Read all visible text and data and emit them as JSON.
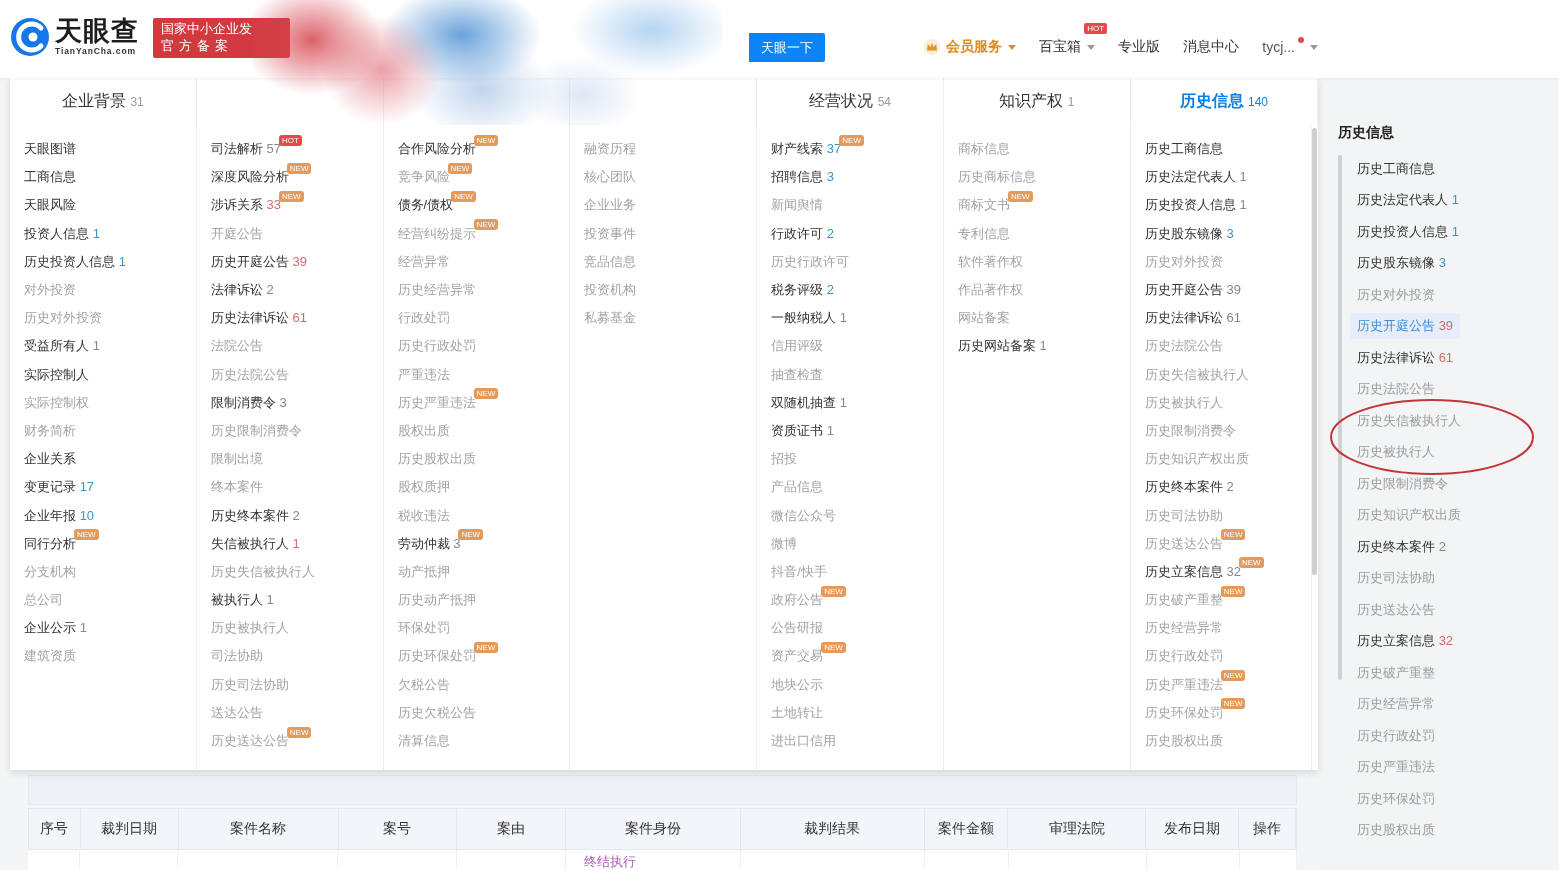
{
  "header": {
    "logo": {
      "name": "天眼查",
      "domain": "TianYanCha.com"
    },
    "certification": [
      "国家中小企业发",
      "官方备案"
    ],
    "search_button": "天眼一下",
    "nav": [
      {
        "kind": "member",
        "label": "会员服务",
        "dropdown": true,
        "unread_dot": false
      },
      {
        "kind": "link",
        "label": "百宝箱",
        "badge": "HOT",
        "dropdown": true,
        "unread_dot": false
      },
      {
        "kind": "link",
        "label": "专业版",
        "dropdown": false,
        "unread_dot": false
      },
      {
        "kind": "link",
        "label": "消息中心",
        "dropdown": false,
        "unread_dot": false
      },
      {
        "kind": "user",
        "label": "tycj...",
        "dropdown": true,
        "unread_dot": true
      }
    ]
  },
  "menu_columns": [
    {
      "tab": {
        "label": "企业背景",
        "count": "31",
        "selected": false
      },
      "items": [
        {
          "label": "天眼图谱",
          "disabled": false
        },
        {
          "label": "工商信息",
          "disabled": false
        },
        {
          "label": "天眼风险",
          "disabled": false
        },
        {
          "label": "投资人信息",
          "count": {
            "text": "1",
            "kind": "info"
          },
          "disabled": false
        },
        {
          "label": "历史投资人信息",
          "count": {
            "text": "1",
            "kind": "info"
          },
          "disabled": false
        },
        {
          "label": "对外投资",
          "disabled": true
        },
        {
          "label": "历史对外投资",
          "disabled": true
        },
        {
          "label": "受益所有人",
          "count": {
            "text": "1",
            "kind": "plain"
          },
          "disabled": false
        },
        {
          "label": "实际控制人",
          "disabled": false
        },
        {
          "label": "实际控制权",
          "disabled": true
        },
        {
          "label": "财务简析",
          "disabled": true
        },
        {
          "label": "企业关系",
          "disabled": false
        },
        {
          "label": "变更记录",
          "count": {
            "text": "17",
            "kind": "info"
          },
          "disabled": false
        },
        {
          "label": "企业年报",
          "count": {
            "text": "10",
            "kind": "info"
          },
          "disabled": false
        },
        {
          "label": "同行分析",
          "badge": {
            "text": "NEW",
            "kind": "new"
          },
          "disabled": false
        },
        {
          "label": "分支机构",
          "disabled": true
        },
        {
          "label": "总公司",
          "disabled": true
        },
        {
          "label": "企业公示",
          "count": {
            "text": "1",
            "kind": "plain"
          },
          "disabled": false
        },
        {
          "label": "建筑资质",
          "disabled": true
        }
      ]
    },
    {
      "items": [
        {
          "label": "司法解析",
          "count": {
            "text": "57",
            "kind": "plain"
          },
          "badge": {
            "text": "HOT",
            "kind": "hot"
          },
          "disabled": false
        },
        {
          "label": "深度风险分析",
          "badge": {
            "text": "NEW",
            "kind": "new"
          },
          "disabled": false
        },
        {
          "label": "涉诉关系",
          "count": {
            "text": "33",
            "kind": "risk"
          },
          "badge": {
            "text": "NEW",
            "kind": "new"
          },
          "disabled": false
        },
        {
          "label": "开庭公告",
          "disabled": true
        },
        {
          "label": "历史开庭公告",
          "count": {
            "text": "39",
            "kind": "risk"
          },
          "disabled": false
        },
        {
          "label": "法律诉讼",
          "count": {
            "text": "2",
            "kind": "plain"
          },
          "disabled": false
        },
        {
          "label": "历史法律诉讼",
          "count": {
            "text": "61",
            "kind": "risk"
          },
          "disabled": false
        },
        {
          "label": "法院公告",
          "disabled": true
        },
        {
          "label": "历史法院公告",
          "disabled": true
        },
        {
          "label": "限制消费令",
          "count": {
            "text": "3",
            "kind": "plain"
          },
          "disabled": false
        },
        {
          "label": "历史限制消费令",
          "disabled": true
        },
        {
          "label": "限制出境",
          "disabled": true
        },
        {
          "label": "终本案件",
          "disabled": true
        },
        {
          "label": "历史终本案件",
          "count": {
            "text": "2",
            "kind": "plain"
          },
          "disabled": false
        },
        {
          "label": "失信被执行人",
          "count": {
            "text": "1",
            "kind": "risk"
          },
          "disabled": false
        },
        {
          "label": "历史失信被执行人",
          "disabled": true
        },
        {
          "label": "被执行人",
          "count": {
            "text": "1",
            "kind": "plain"
          },
          "disabled": false
        },
        {
          "label": "历史被执行人",
          "disabled": true
        },
        {
          "label": "司法协助",
          "disabled": true
        },
        {
          "label": "历史司法协助",
          "disabled": true
        },
        {
          "label": "送达公告",
          "disabled": true
        },
        {
          "label": "历史送达公告",
          "badge": {
            "text": "NEW",
            "kind": "new"
          },
          "disabled": true
        }
      ]
    },
    {
      "items": [
        {
          "label": "合作风险分析",
          "badge": {
            "text": "NEW",
            "kind": "new"
          },
          "disabled": false
        },
        {
          "label": "竞争风险",
          "badge": {
            "text": "NEW",
            "kind": "new"
          },
          "disabled": true
        },
        {
          "label": "债务/债权",
          "badge": {
            "text": "NEW",
            "kind": "new"
          },
          "disabled": false
        },
        {
          "label": "经营纠纷提示",
          "badge": {
            "text": "NEW",
            "kind": "new"
          },
          "disabled": true
        },
        {
          "label": "经营异常",
          "disabled": true
        },
        {
          "label": "历史经营异常",
          "disabled": true
        },
        {
          "label": "行政处罚",
          "disabled": true
        },
        {
          "label": "历史行政处罚",
          "disabled": true
        },
        {
          "label": "严重违法",
          "disabled": true
        },
        {
          "label": "历史严重违法",
          "badge": {
            "text": "NEW",
            "kind": "new"
          },
          "disabled": true
        },
        {
          "label": "股权出质",
          "disabled": true
        },
        {
          "label": "历史股权出质",
          "disabled": true
        },
        {
          "label": "股权质押",
          "disabled": true
        },
        {
          "label": "税收违法",
          "disabled": true
        },
        {
          "label": "劳动仲裁",
          "count": {
            "text": "3",
            "kind": "plain"
          },
          "badge": {
            "text": "NEW",
            "kind": "new"
          },
          "disabled": false
        },
        {
          "label": "动产抵押",
          "disabled": true
        },
        {
          "label": "历史动产抵押",
          "disabled": true
        },
        {
          "label": "环保处罚",
          "disabled": true
        },
        {
          "label": "历史环保处罚",
          "badge": {
            "text": "NEW",
            "kind": "new"
          },
          "disabled": true
        },
        {
          "label": "欠税公告",
          "disabled": true
        },
        {
          "label": "历史欠税公告",
          "disabled": true
        },
        {
          "label": "清算信息",
          "disabled": true
        }
      ]
    },
    {
      "items": [
        {
          "label": "融资历程",
          "disabled": true
        },
        {
          "label": "核心团队",
          "disabled": true
        },
        {
          "label": "企业业务",
          "disabled": true
        },
        {
          "label": "投资事件",
          "disabled": true
        },
        {
          "label": "竞品信息",
          "disabled": true
        },
        {
          "label": "投资机构",
          "disabled": true
        },
        {
          "label": "私募基金",
          "disabled": true
        }
      ]
    },
    {
      "tab": {
        "label": "经营状况",
        "count": "54",
        "selected": false
      },
      "items": [
        {
          "label": "财产线索",
          "count": {
            "text": "37",
            "kind": "info"
          },
          "badge": {
            "text": "NEW",
            "kind": "new"
          },
          "disabled": false
        },
        {
          "label": "招聘信息",
          "count": {
            "text": "3",
            "kind": "info"
          },
          "disabled": false
        },
        {
          "label": "新闻舆情",
          "disabled": true
        },
        {
          "label": "行政许可",
          "count": {
            "text": "2",
            "kind": "info"
          },
          "disabled": false
        },
        {
          "label": "历史行政许可",
          "disabled": true
        },
        {
          "label": "税务评级",
          "count": {
            "text": "2",
            "kind": "info"
          },
          "disabled": false
        },
        {
          "label": "一般纳税人",
          "count": {
            "text": "1",
            "kind": "plain"
          },
          "disabled": false
        },
        {
          "label": "信用评级",
          "disabled": true
        },
        {
          "label": "抽查检查",
          "disabled": true
        },
        {
          "label": "双随机抽查",
          "count": {
            "text": "1",
            "kind": "plain"
          },
          "disabled": false
        },
        {
          "label": "资质证书",
          "count": {
            "text": "1",
            "kind": "plain"
          },
          "disabled": false
        },
        {
          "label": "招投",
          "disabled": true
        },
        {
          "label": "产品信息",
          "disabled": true
        },
        {
          "label": "微信公众号",
          "disabled": true
        },
        {
          "label": "微博",
          "disabled": true
        },
        {
          "label": "抖音/快手",
          "disabled": true
        },
        {
          "label": "政府公告",
          "badge": {
            "text": "NEW",
            "kind": "new"
          },
          "disabled": true
        },
        {
          "label": "公告研报",
          "disabled": true
        },
        {
          "label": "资产交易",
          "badge": {
            "text": "NEW",
            "kind": "new"
          },
          "disabled": true
        },
        {
          "label": "地块公示",
          "disabled": true
        },
        {
          "label": "土地转让",
          "disabled": true
        },
        {
          "label": "进出口信用",
          "disabled": true
        }
      ]
    },
    {
      "tab": {
        "label": "知识产权",
        "count": "1",
        "selected": false
      },
      "items": [
        {
          "label": "商标信息",
          "disabled": true
        },
        {
          "label": "历史商标信息",
          "disabled": true
        },
        {
          "label": "商标文书",
          "badge": {
            "text": "NEW",
            "kind": "new"
          },
          "disabled": true
        },
        {
          "label": "专利信息",
          "disabled": true
        },
        {
          "label": "软件著作权",
          "disabled": true
        },
        {
          "label": "作品著作权",
          "disabled": true
        },
        {
          "label": "网站备案",
          "disabled": true
        },
        {
          "label": "历史网站备案",
          "count": {
            "text": "1",
            "kind": "plain"
          },
          "disabled": false
        }
      ]
    },
    {
      "tab": {
        "label": "历史信息",
        "count": "140",
        "selected": true
      },
      "items": [
        {
          "label": "历史工商信息",
          "disabled": false
        },
        {
          "label": "历史法定代表人",
          "count": {
            "text": "1",
            "kind": "plain"
          },
          "disabled": false
        },
        {
          "label": "历史投资人信息",
          "count": {
            "text": "1",
            "kind": "plain"
          },
          "disabled": false
        },
        {
          "label": "历史股东镜像",
          "count": {
            "text": "3",
            "kind": "info"
          },
          "disabled": false
        },
        {
          "label": "历史对外投资",
          "disabled": true
        },
        {
          "label": "历史开庭公告",
          "count": {
            "text": "39",
            "kind": "plain"
          },
          "disabled": false
        },
        {
          "label": "历史法律诉讼",
          "count": {
            "text": "61",
            "kind": "plain"
          },
          "disabled": false
        },
        {
          "label": "历史法院公告",
          "disabled": true
        },
        {
          "label": "历史失信被执行人",
          "disabled": true
        },
        {
          "label": "历史被执行人",
          "disabled": true
        },
        {
          "label": "历史限制消费令",
          "disabled": true
        },
        {
          "label": "历史知识产权出质",
          "disabled": true
        },
        {
          "label": "历史终本案件",
          "count": {
            "text": "2",
            "kind": "plain"
          },
          "disabled": false
        },
        {
          "label": "历史司法协助",
          "disabled": true
        },
        {
          "label": "历史送达公告",
          "badge": {
            "text": "NEW",
            "kind": "new"
          },
          "disabled": true
        },
        {
          "label": "历史立案信息",
          "count": {
            "text": "32",
            "kind": "plain"
          },
          "badge": {
            "text": "NEW",
            "kind": "new"
          },
          "disabled": false
        },
        {
          "label": "历史破产重整",
          "badge": {
            "text": "NEW",
            "kind": "new"
          },
          "disabled": true
        },
        {
          "label": "历史经营异常",
          "disabled": true
        },
        {
          "label": "历史行政处罚",
          "disabled": true
        },
        {
          "label": "历史严重违法",
          "badge": {
            "text": "NEW",
            "kind": "new"
          },
          "disabled": true
        },
        {
          "label": "历史环保处罚",
          "badge": {
            "text": "NEW",
            "kind": "new"
          },
          "disabled": true
        },
        {
          "label": "历史股权出质",
          "disabled": true
        }
      ]
    }
  ],
  "sidebar": {
    "title": "历史信息",
    "items": [
      {
        "label": "历史工商信息",
        "selected": false,
        "disabled": false
      },
      {
        "label": "历史法定代表人",
        "count": {
          "text": "1",
          "kind": "info"
        },
        "selected": false,
        "disabled": false
      },
      {
        "label": "历史投资人信息",
        "count": {
          "text": "1",
          "kind": "info"
        },
        "selected": false,
        "disabled": false
      },
      {
        "label": "历史股东镜像",
        "count": {
          "text": "3",
          "kind": "info"
        },
        "selected": false,
        "disabled": false
      },
      {
        "label": "历史对外投资",
        "selected": false,
        "disabled": true
      },
      {
        "label": "历史开庭公告",
        "count": {
          "text": "39",
          "kind": "risk"
        },
        "selected": true,
        "disabled": false
      },
      {
        "label": "历史法律诉讼",
        "count": {
          "text": "61",
          "kind": "risk"
        },
        "selected": false,
        "disabled": false
      },
      {
        "label": "历史法院公告",
        "selected": false,
        "disabled": true
      },
      {
        "label": "历史失信被执行人",
        "selected": false,
        "disabled": true
      },
      {
        "label": "历史被执行人",
        "selected": false,
        "disabled": true
      },
      {
        "label": "历史限制消费令",
        "selected": false,
        "disabled": true
      },
      {
        "label": "历史知识产权出质",
        "selected": false,
        "disabled": true
      },
      {
        "label": "历史终本案件",
        "count": {
          "text": "2",
          "kind": "plain"
        },
        "selected": false,
        "disabled": false
      },
      {
        "label": "历史司法协助",
        "selected": false,
        "disabled": true
      },
      {
        "label": "历史送达公告",
        "selected": false,
        "disabled": true
      },
      {
        "label": "历史立案信息",
        "count": {
          "text": "32",
          "kind": "risk"
        },
        "selected": false,
        "disabled": false
      },
      {
        "label": "历史破产重整",
        "selected": false,
        "disabled": true
      },
      {
        "label": "历史经营异常",
        "selected": false,
        "disabled": true
      },
      {
        "label": "历史行政处罚",
        "selected": false,
        "disabled": true
      },
      {
        "label": "历史严重违法",
        "selected": false,
        "disabled": true
      },
      {
        "label": "历史环保处罚",
        "selected": false,
        "disabled": true
      },
      {
        "label": "历史股权出质",
        "selected": false,
        "disabled": true
      }
    ]
  },
  "table": {
    "columns": [
      "序号",
      "裁判日期",
      "案件名称",
      "案号",
      "案由",
      "案件身份",
      "裁判结果",
      "案件金额",
      "审理法院",
      "发布日期",
      "操作"
    ],
    "rows": [
      {
        "case_role": "终结执行"
      }
    ]
  }
}
